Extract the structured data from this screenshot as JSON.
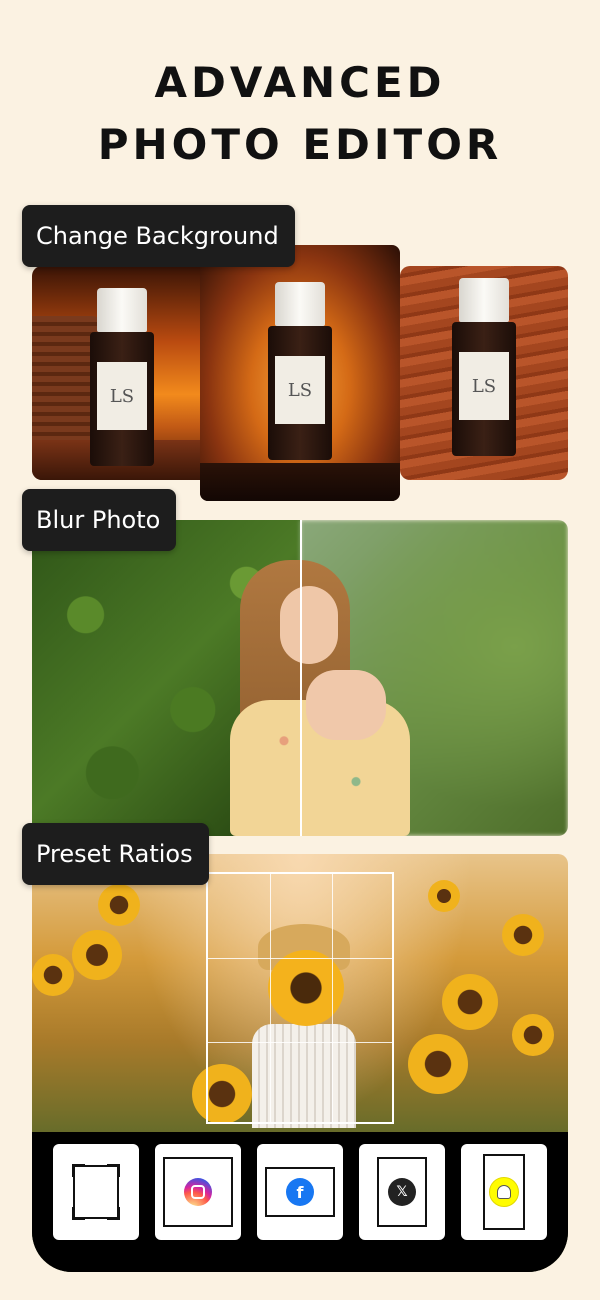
{
  "title": {
    "line1": "ADVANCED",
    "line2": "PHOTO EDITOR"
  },
  "features": {
    "change_background": {
      "label": "Change Background",
      "bottle_label": "LS"
    },
    "blur_photo": {
      "label": "Blur Photo"
    },
    "preset_ratios": {
      "label": "Preset Ratios"
    }
  },
  "ratio_buttons": [
    {
      "name": "free-ratio",
      "icon": "crop-frame-icon"
    },
    {
      "name": "instagram",
      "icon": "instagram-icon",
      "color": "#d6249f"
    },
    {
      "name": "facebook",
      "icon": "facebook-icon",
      "glyph": "f",
      "color": "#1877f2"
    },
    {
      "name": "x",
      "icon": "x-icon",
      "glyph": "𝕏",
      "color": "#222222"
    },
    {
      "name": "snapchat",
      "icon": "snapchat-icon",
      "color": "#fffc00"
    }
  ],
  "colors": {
    "background": "#fbf2e2",
    "label_bg": "#1d1d1d",
    "text": "#111111"
  }
}
